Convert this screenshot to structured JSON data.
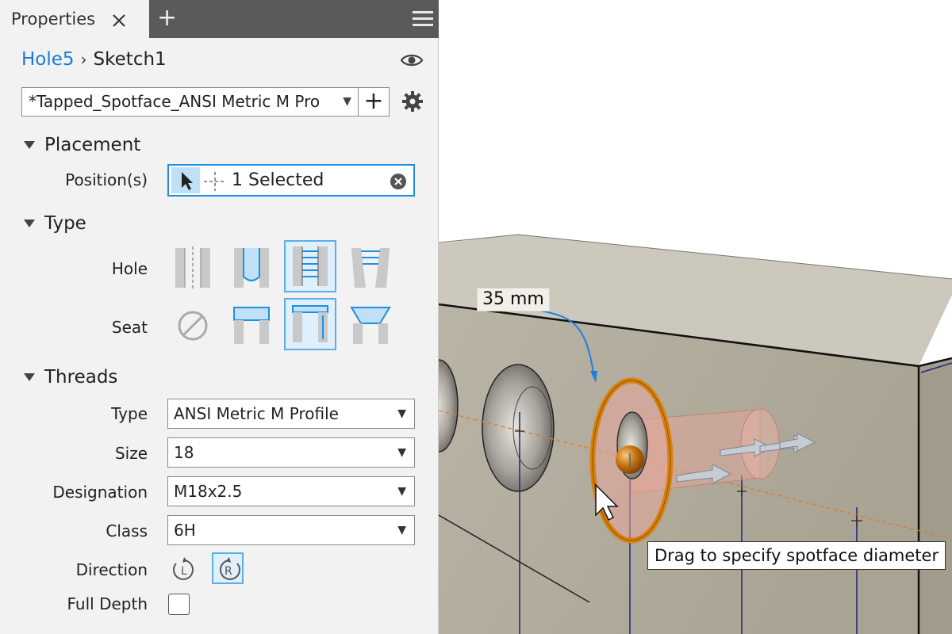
{
  "panel": {
    "tab_label": "Properties",
    "breadcrumb": {
      "feature": "Hole5",
      "sketch": "Sketch1"
    },
    "preset_value": "*Tapped_Spotface_ANSI Metric M Pro",
    "placement": {
      "header": "Placement",
      "positions_label": "Position(s)",
      "positions_value": "1 Selected"
    },
    "type": {
      "header": "Type",
      "hole_label": "Hole",
      "seat_label": "Seat"
    },
    "threads": {
      "header": "Threads",
      "type_label": "Type",
      "type_value": "ANSI Metric M Profile",
      "size_label": "Size",
      "size_value": "18",
      "designation_label": "Designation",
      "designation_value": "M18x2.5",
      "class_label": "Class",
      "class_value": "6H",
      "direction_label": "Direction",
      "full_depth_label": "Full Depth"
    }
  },
  "viewport": {
    "dimension_label": "35 mm",
    "tooltip": "Drag to specify spotface diameter"
  },
  "colors": {
    "accent": "#1f8fe0",
    "selection_fill": "#dfeffb",
    "model_face": "#b3ad9d",
    "spotface_ring": "#d9800d"
  }
}
